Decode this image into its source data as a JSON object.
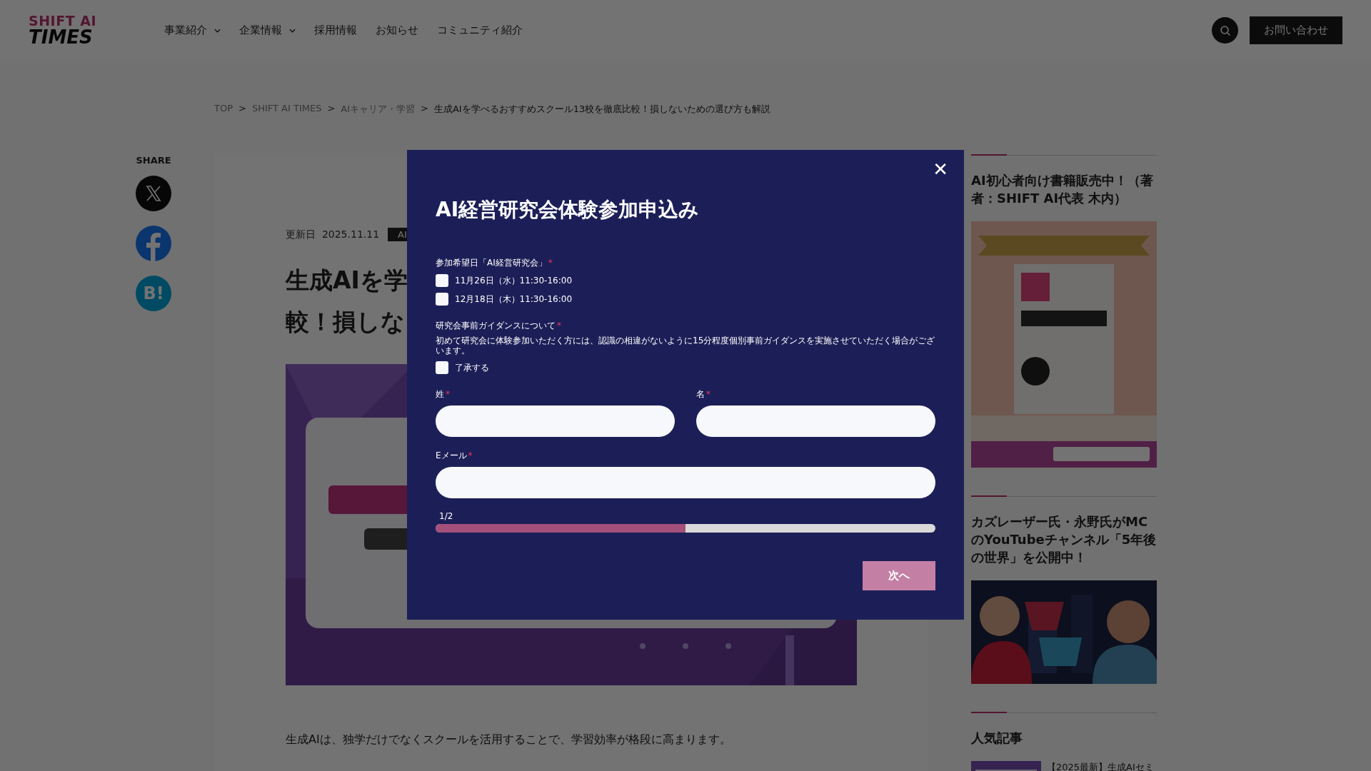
{
  "header": {
    "logo": {
      "line1": "SHIFT AI",
      "line2": "TIMES"
    },
    "nav": [
      {
        "label": "事業紹介",
        "has_dropdown": true
      },
      {
        "label": "企業情報",
        "has_dropdown": true
      },
      {
        "label": "採用情報",
        "has_dropdown": false
      },
      {
        "label": "お知らせ",
        "has_dropdown": false
      },
      {
        "label": "コミュニティ紹介",
        "has_dropdown": false
      }
    ],
    "contact_button": "お問い合わせ"
  },
  "breadcrumb": [
    {
      "label": "TOP",
      "current": false
    },
    {
      "label": "SHIFT AI TIMES",
      "current": false
    },
    {
      "label": "AIキャリア・学習",
      "current": false
    },
    {
      "label": "生成AIを学べるおすすめスクール13校を徹底比較！損しないための選び方も解説",
      "current": true
    }
  ],
  "breadcrumb_separator": ">",
  "share": {
    "label": "SHARE",
    "buttons": [
      {
        "kind": "x"
      },
      {
        "kind": "facebook"
      },
      {
        "kind": "hatena",
        "text": "B!"
      }
    ]
  },
  "article": {
    "updated_label": "更新日",
    "updated_date": "2025.11.11",
    "category_tag": "AI",
    "title_lines": [
      "生成AIを学",
      "較！損しな"
    ],
    "image": {
      "kind": "picture"
    },
    "paragraph": "生成AIは、独学だけでなくスクールを活用することで、学習効率が格段に高まります。"
  },
  "sidebar": [
    {
      "kind": "banner",
      "title": "AI初心者向け書籍販売中！（著者：SHIFT AI代表 木内）"
    },
    {
      "kind": "video",
      "title": "カズレーザー氏・永野氏がMCのYouTubeチャンネル「5年後の世界」を公開中！"
    },
    {
      "kind": "list",
      "title": "人気記事",
      "items": [
        {
          "title": "【2025最新】生成AIセミ"
        }
      ]
    }
  ],
  "modal": {
    "title": "AI経営研究会体験参加申込み",
    "close": "✕",
    "date_group": {
      "label": "参加希望日「AI経営研究会」",
      "required_mark": "*",
      "options": [
        {
          "label": "11月26日（水）11:30-16:00",
          "checked": false
        },
        {
          "label": "12月18日（木）11:30-16:00",
          "checked": false
        }
      ]
    },
    "guidance": {
      "label": "研究会事前ガイダンスについて",
      "required_mark": "*",
      "description": "初めて研究会に体験参加いただく方には、認識の相違がないように15分程度個別事前ガイダンスを実施させていただく場合がございます。",
      "agree": {
        "label": "了承する",
        "checked": false
      }
    },
    "name_fields": [
      {
        "label": "姓",
        "required_mark": "*"
      },
      {
        "label": "名",
        "required_mark": "*"
      }
    ],
    "email_field": {
      "label": "Eメール",
      "required_mark": "*"
    },
    "progress": {
      "text": "1/2",
      "level": 0.5
    },
    "next_button": "次へ"
  }
}
